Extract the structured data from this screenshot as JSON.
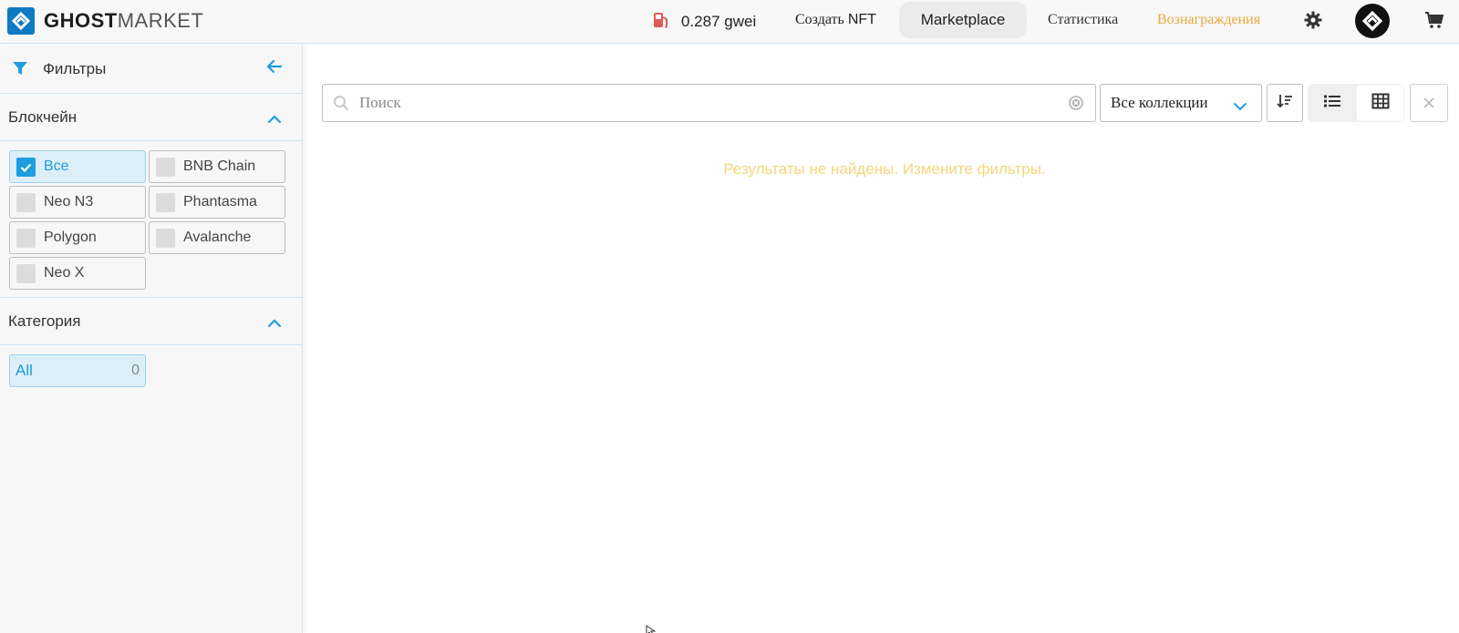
{
  "header": {
    "logo": {
      "bold": "GHOST",
      "light": "MARKET"
    },
    "gas": {
      "value": "0.287 gwei",
      "icon": "gas-pump-icon",
      "icon_color": "#e05a5a"
    },
    "nav": {
      "create_prefix": "Создать",
      "create_suffix": "NFT",
      "marketplace": "Marketplace",
      "stats": "Статистика",
      "rewards": "Вознаграждения"
    },
    "icons": [
      "gear-icon",
      "avatar",
      "cart-icon"
    ]
  },
  "sidebar": {
    "title": "Фильтры",
    "blockchain": {
      "title": "Блокчейн",
      "chips": [
        {
          "label": "Все",
          "checked": true
        },
        {
          "label": "BNB Chain",
          "checked": false
        },
        {
          "label": "Neo N3",
          "checked": false
        },
        {
          "label": "Phantasma",
          "checked": false
        },
        {
          "label": "Polygon",
          "checked": false
        },
        {
          "label": "Avalanche",
          "checked": false
        },
        {
          "label": "Neo X",
          "checked": false
        }
      ]
    },
    "category": {
      "title": "Категория",
      "chips": [
        {
          "label": "All",
          "count": "0"
        }
      ]
    }
  },
  "main": {
    "search": {
      "placeholder": "Поиск",
      "value": ""
    },
    "collection_select": {
      "selected": "Все коллекции"
    },
    "empty_message": "Результаты не найдены. Измените фильтры."
  },
  "colors": {
    "accent": "#1e9ee0",
    "brand": "#0d7ac3",
    "rewards": "#e8a93a",
    "empty_message": "#f3d77b"
  }
}
